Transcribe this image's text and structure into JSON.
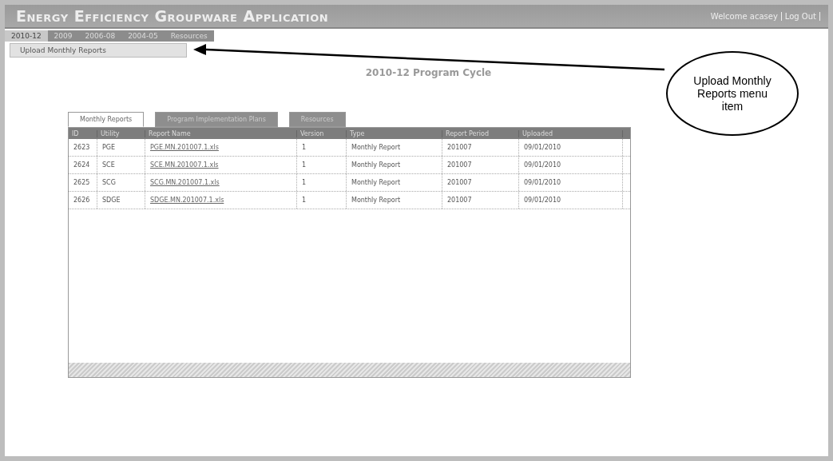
{
  "header": {
    "title": "Energy Efficiency Groupware Application",
    "welcome": "Welcome acasey",
    "logout": "Log Out"
  },
  "nav_tabs": [
    {
      "label": "2010-12",
      "selected": true
    },
    {
      "label": "2009",
      "selected": false
    },
    {
      "label": "2006-08",
      "selected": false
    },
    {
      "label": "2004-05",
      "selected": false
    },
    {
      "label": "Resources",
      "selected": false
    }
  ],
  "submenu": [
    "Upload Monthly Reports"
  ],
  "heading": "2010-12 Program Cycle",
  "callout": "Upload Monthly Reports menu item",
  "panel_tabs": [
    {
      "label": "Monthly Reports",
      "selected": true
    },
    {
      "label": "Program Implementation Plans",
      "selected": false
    },
    {
      "label": "Resources",
      "selected": false
    }
  ],
  "table": {
    "columns": [
      "ID",
      "Utility",
      "Report Name",
      "Version",
      "Type",
      "Report Period",
      "Uploaded"
    ],
    "rows": [
      [
        "2623",
        "PGE",
        "PGE.MN.201007.1.xls",
        "1",
        "Monthly Report",
        "201007",
        "09/01/2010"
      ],
      [
        "2624",
        "SCE",
        "SCE.MN.201007.1.xls",
        "1",
        "Monthly Report",
        "201007",
        "09/01/2010"
      ],
      [
        "2625",
        "SCG",
        "SCG.MN.201007.1.xls",
        "1",
        "Monthly Report",
        "201007",
        "09/01/2010"
      ],
      [
        "2626",
        "SDGE",
        "SDGE.MN.201007.1.xls",
        "1",
        "Monthly Report",
        "201007",
        "09/01/2010"
      ]
    ]
  }
}
